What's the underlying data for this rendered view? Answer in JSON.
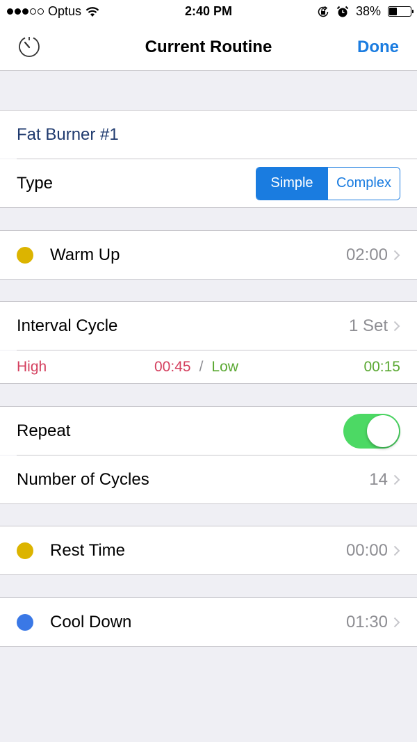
{
  "status_bar": {
    "signal_filled": 3,
    "signal_total": 5,
    "carrier": "Optus",
    "time": "2:40 PM",
    "battery_percent": "38%",
    "battery_level": 0.38
  },
  "nav": {
    "title": "Current Routine",
    "done_label": "Done",
    "left_icon": "timer-icon"
  },
  "routine": {
    "name": "Fat Burner #1",
    "type_label": "Type",
    "type_options": [
      "Simple",
      "Complex"
    ],
    "type_selected": "Simple"
  },
  "warm_up": {
    "label": "Warm Up",
    "value": "02:00",
    "color": "#dcb400"
  },
  "interval": {
    "label": "Interval Cycle",
    "value": "1 Set",
    "high_label": "High",
    "high_value": "00:45",
    "divider": "/",
    "low_label": "Low",
    "low_value": "00:15",
    "high_color": "#d43f5e",
    "low_color": "#5aa832"
  },
  "repeat": {
    "label": "Repeat",
    "on": true
  },
  "cycles": {
    "label": "Number of Cycles",
    "value": "14"
  },
  "rest": {
    "label": "Rest Time",
    "value": "00:00",
    "color": "#dcb400"
  },
  "cool_down": {
    "label": "Cool Down",
    "value": "01:30",
    "color": "#3a78e6"
  },
  "colors": {
    "accent": "#1a7ce0",
    "toggle_on": "#4cd964"
  }
}
